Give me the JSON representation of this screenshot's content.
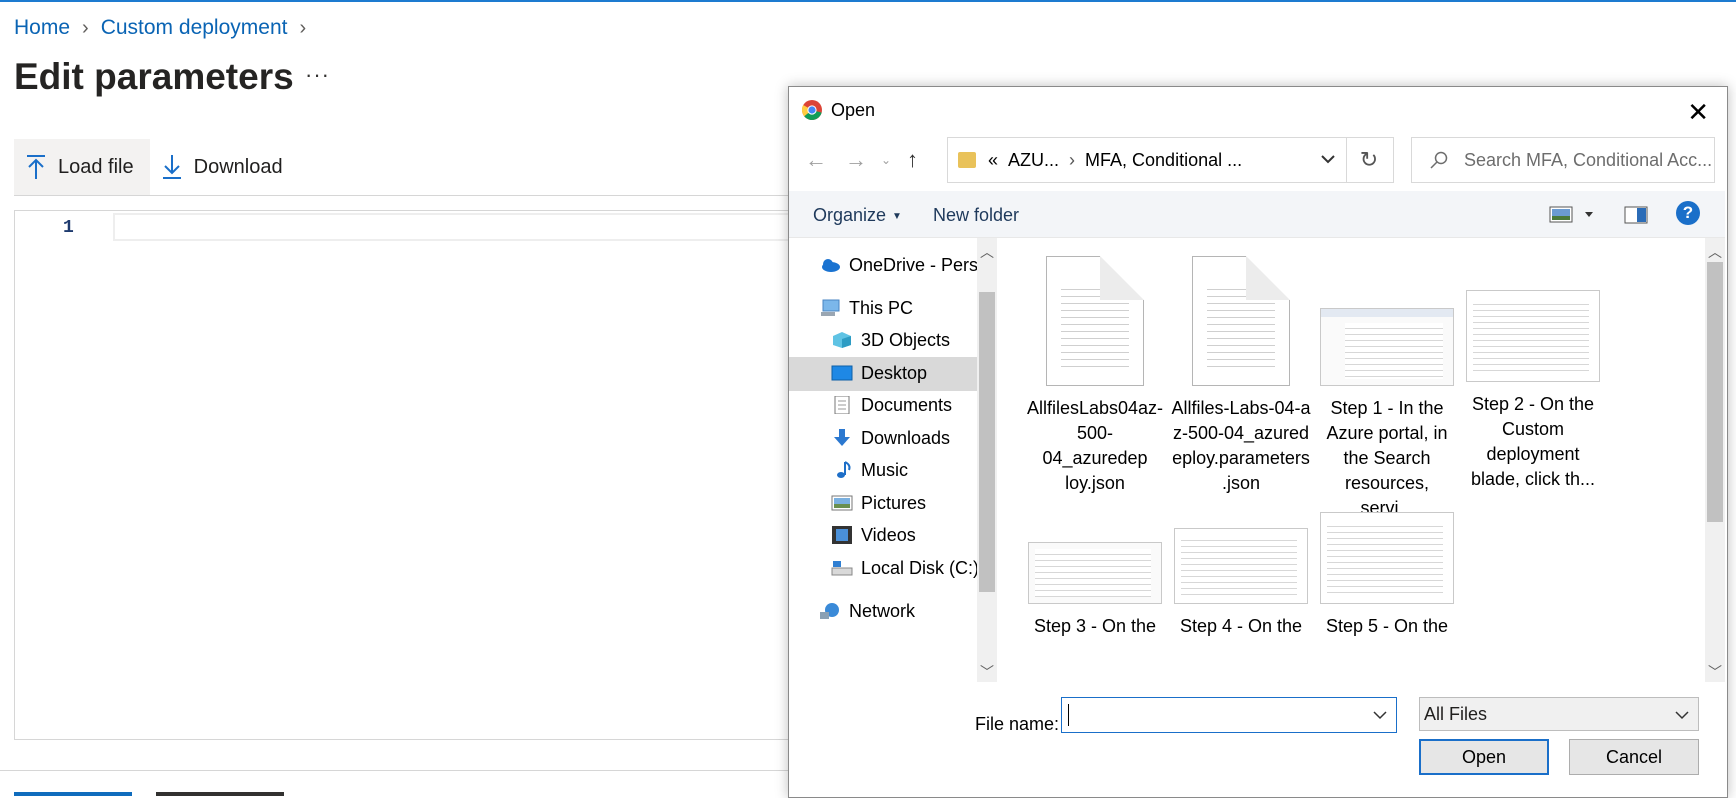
{
  "breadcrumb": {
    "items": [
      "Home",
      "Custom deployment"
    ]
  },
  "page": {
    "title": "Edit parameters",
    "more": "···"
  },
  "toolbar": {
    "load_file": "Load file",
    "download": "Download"
  },
  "editor": {
    "line_number": "1"
  },
  "dialog": {
    "title": "Open",
    "address": {
      "prefix": "«",
      "segments": [
        "AZU...",
        "MFA, Conditional ..."
      ]
    },
    "search_placeholder": "Search MFA, Conditional Acc...",
    "commands": {
      "organize": "Organize",
      "new_folder": "New folder"
    },
    "nav": {
      "items": [
        "OneDrive - Person",
        "This PC",
        "3D Objects",
        "Desktop",
        "Documents",
        "Downloads",
        "Music",
        "Pictures",
        "Videos",
        "Local Disk (C:)",
        "Network"
      ],
      "selected": "Desktop"
    },
    "files": [
      {
        "name_lines": [
          "AllfilesLabs04az-",
          "500-04_azuredep",
          "loy.json"
        ],
        "kind": "document"
      },
      {
        "name_lines": [
          "Allfiles-Labs-04-a",
          "z-500-04_azured",
          "eploy.parameters",
          ".json"
        ],
        "kind": "document"
      },
      {
        "name_lines": [
          "Step 1 - In the",
          "Azure portal, in",
          "the Search",
          "resources, servi..."
        ],
        "kind": "screenshot"
      },
      {
        "name_lines": [
          "Step 2 - On the",
          "Custom",
          "deployment",
          "blade, click th..."
        ],
        "kind": "screenshot"
      },
      {
        "name_lines": [
          "Step 3 - On the"
        ],
        "kind": "screenshot"
      },
      {
        "name_lines": [
          "Step 4 - On the"
        ],
        "kind": "screenshot"
      },
      {
        "name_lines": [
          "Step 5 - On the"
        ],
        "kind": "screenshot"
      }
    ],
    "file_name_label": "File name:",
    "file_name_value": "",
    "file_type": "All Files",
    "open_button": "Open",
    "cancel_button": "Cancel"
  },
  "colors": {
    "accent": "#0f6cbd",
    "link": "#0a64b4",
    "selection": "#d9d9d9"
  }
}
